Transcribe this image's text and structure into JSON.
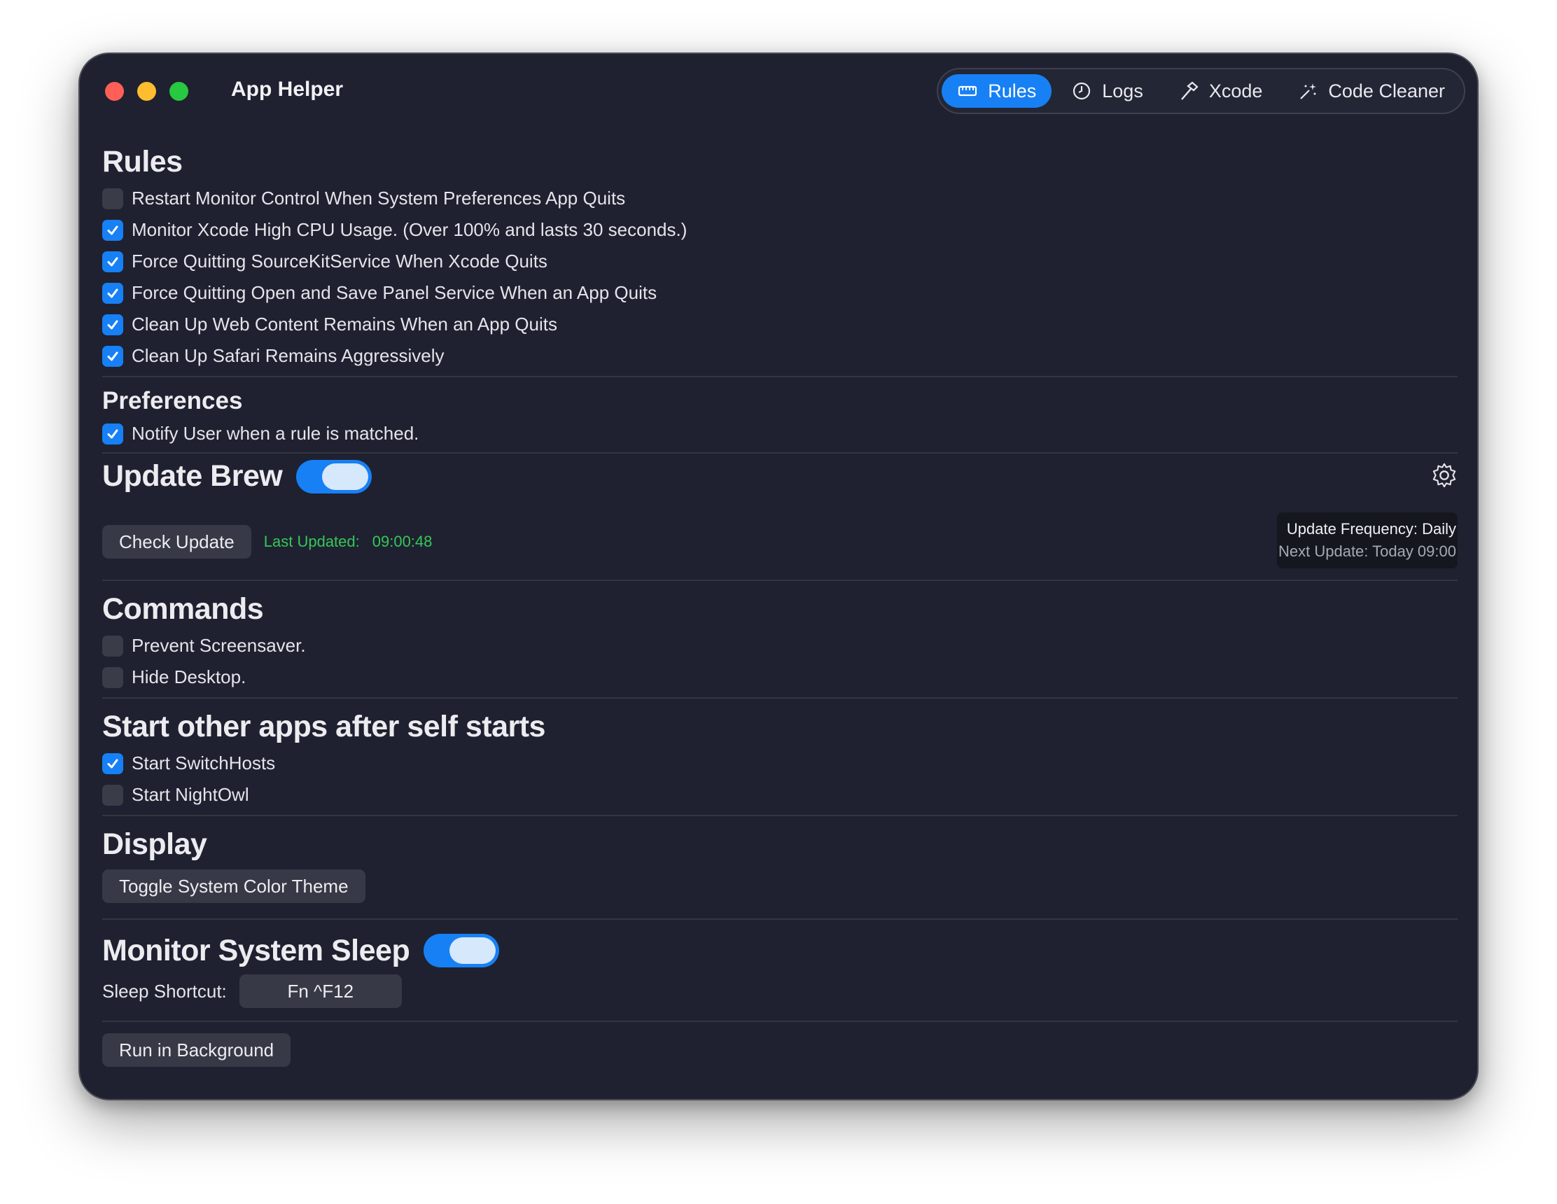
{
  "window": {
    "title": "App Helper"
  },
  "toolbar": {
    "tabs": [
      {
        "label": "Rules",
        "icon": "ruler-icon",
        "active": true
      },
      {
        "label": "Logs",
        "icon": "clock-icon",
        "active": false
      },
      {
        "label": "Xcode",
        "icon": "hammer-icon",
        "active": false
      },
      {
        "label": "Code Cleaner",
        "icon": "sparkle-wand-icon",
        "active": false
      }
    ]
  },
  "rules": {
    "title": "Rules",
    "items": [
      {
        "label": "Restart Monitor Control When System Preferences App Quits",
        "checked": false
      },
      {
        "label": "Monitor Xcode High CPU Usage. (Over 100% and lasts 30 seconds.)",
        "checked": true
      },
      {
        "label": "Force Quitting SourceKitService When Xcode Quits",
        "checked": true
      },
      {
        "label": "Force Quitting Open and Save Panel Service When an App Quits",
        "checked": true
      },
      {
        "label": "Clean Up Web Content Remains When an App Quits",
        "checked": true
      },
      {
        "label": "Clean Up Safari Remains Aggressively",
        "checked": true
      }
    ]
  },
  "preferences": {
    "title": "Preferences",
    "items": [
      {
        "label": "Notify User when a rule is matched.",
        "checked": true
      }
    ]
  },
  "brew": {
    "title": "Update Brew",
    "enabled": true,
    "check_button": "Check Update",
    "last_updated_label": "Last Updated:",
    "last_updated_value": "09:00:48",
    "frequency": "Update Frequency: Daily",
    "next_update": "Next Update: Today 09:00"
  },
  "commands": {
    "title": "Commands",
    "items": [
      {
        "label": "Prevent Screensaver.",
        "checked": false
      },
      {
        "label": "Hide Desktop.",
        "checked": false
      }
    ]
  },
  "startapps": {
    "title": "Start other apps after self starts",
    "items": [
      {
        "label": "Start SwitchHosts",
        "checked": true
      },
      {
        "label": "Start NightOwl",
        "checked": false
      }
    ]
  },
  "display": {
    "title": "Display",
    "button": "Toggle System Color Theme"
  },
  "sleep": {
    "title": "Monitor System Sleep",
    "enabled": true,
    "shortcut_label": "Sleep Shortcut:",
    "shortcut_value": "Fn ^F12"
  },
  "footer": {
    "run_bg_button": "Run in Background"
  },
  "colors": {
    "accent": "#1780f5",
    "window_bg": "#1f2130",
    "success": "#35c759"
  }
}
